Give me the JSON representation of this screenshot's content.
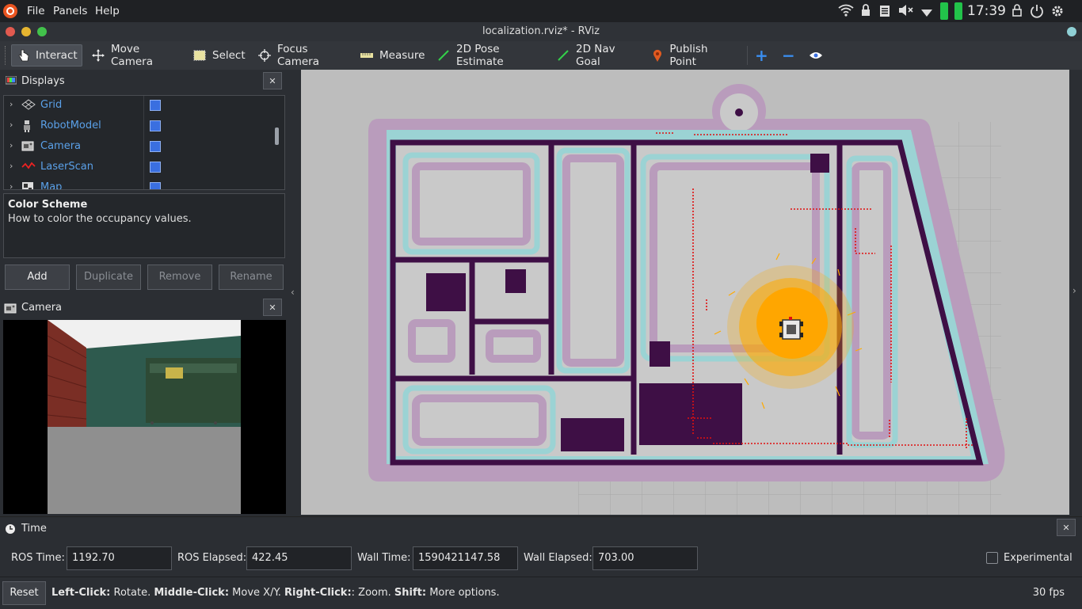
{
  "system_bar": {
    "menus": [
      "File",
      "Panels",
      "Help"
    ],
    "clock": "17:39"
  },
  "window": {
    "title": "localization.rviz* - RViz"
  },
  "toolbar": {
    "tools": [
      {
        "label": "Interact",
        "icon": "cursor-hand-icon",
        "active": true
      },
      {
        "label": "Move Camera",
        "icon": "move-camera-icon"
      },
      {
        "label": "Select",
        "icon": "select-icon"
      },
      {
        "label": "Focus Camera",
        "icon": "focus-camera-icon"
      },
      {
        "label": "Measure",
        "icon": "ruler-icon"
      },
      {
        "label": "2D Pose Estimate",
        "icon": "pose-estimate-arrow-icon"
      },
      {
        "label": "2D Nav Goal",
        "icon": "nav-goal-arrow-icon"
      },
      {
        "label": "Publish Point",
        "icon": "map-pin-icon"
      }
    ],
    "extra_icons": [
      "plus-icon",
      "minus-icon",
      "eye-icon"
    ]
  },
  "displays_panel": {
    "title": "Displays",
    "items": [
      {
        "label": "Grid",
        "checked": true
      },
      {
        "label": "RobotModel",
        "checked": true
      },
      {
        "label": "Camera",
        "checked": true
      },
      {
        "label": "LaserScan",
        "checked": true
      },
      {
        "label": "Map",
        "checked": true
      }
    ],
    "description_title": "Color Scheme",
    "description_text": "How to color the occupancy values.",
    "buttons": {
      "add": "Add",
      "duplicate": "Duplicate",
      "remove": "Remove",
      "rename": "Rename"
    }
  },
  "camera_panel": {
    "title": "Camera"
  },
  "time_panel": {
    "title": "Time",
    "ros_time_label": "ROS Time:",
    "ros_time": "1192.70",
    "ros_elapsed_label": "ROS Elapsed:",
    "ros_elapsed": "422.45",
    "wall_time_label": "Wall Time:",
    "wall_time": "1590421147.58",
    "wall_elapsed_label": "Wall Elapsed:",
    "wall_elapsed": "703.00",
    "experimental_label": "Experimental",
    "experimental_checked": false
  },
  "status_bar": {
    "reset_label": "Reset",
    "hint_left_key": "Left-Click:",
    "hint_left_val": " Rotate. ",
    "hint_middle_key": "Middle-Click:",
    "hint_middle_val": " Move X/Y. ",
    "hint_right_key": "Right-Click:",
    "hint_right_val": ": Zoom. ",
    "hint_shift_key": "Shift:",
    "hint_shift_val": " More options.",
    "fps": "30 fps"
  },
  "colors": {
    "map_wall": "#3e0f45",
    "map_inflation_inner": "#9bd3d4",
    "map_inflation_outer": "#b99cbc",
    "map_free": "#c9c9c9",
    "particles": "#ffaa00",
    "laser": "#e01010",
    "accent": "#3a6fe0"
  }
}
